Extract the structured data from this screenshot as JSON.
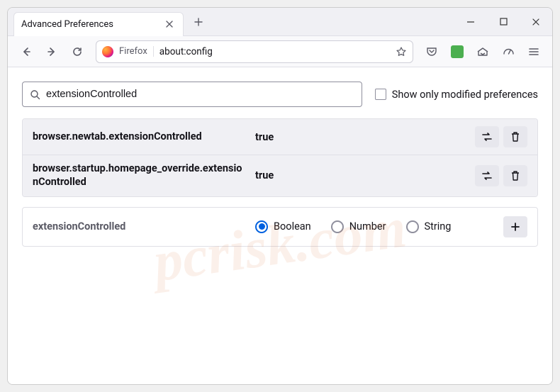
{
  "tab": {
    "title": "Advanced Preferences"
  },
  "urlbar": {
    "label": "Firefox",
    "url": "about:config"
  },
  "search": {
    "value": "extensionControlled"
  },
  "checkbox": {
    "label": "Show only modified preferences"
  },
  "prefs": [
    {
      "name": "browser.newtab.extensionControlled",
      "value": "true"
    },
    {
      "name": "browser.startup.homepage_override.extensionControlled",
      "value": "true"
    }
  ],
  "newPref": {
    "name": "extensionControlled",
    "types": [
      "Boolean",
      "Number",
      "String"
    ],
    "selected": "Boolean"
  },
  "watermark": "pcrisk.com"
}
